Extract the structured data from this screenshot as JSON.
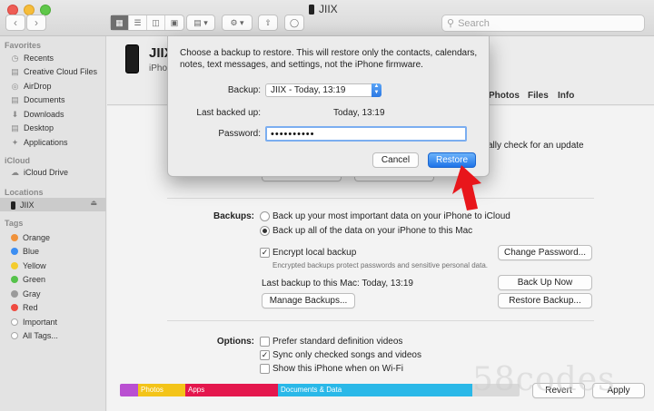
{
  "window": {
    "title": "JIIX",
    "search_placeholder": "Search"
  },
  "sidebar": {
    "favorites_header": "Favorites",
    "favorites": [
      "Recents",
      "Creative Cloud Files",
      "AirDrop",
      "Documents",
      "Downloads",
      "Desktop",
      "Applications"
    ],
    "icloud_header": "iCloud",
    "icloud": [
      "iCloud Drive"
    ],
    "locations_header": "Locations",
    "location": "JIIX",
    "tags_header": "Tags",
    "tags": [
      {
        "label": "Orange",
        "color": "#f0923b"
      },
      {
        "label": "Blue",
        "color": "#3c8ef2"
      },
      {
        "label": "Yellow",
        "color": "#f4cc2e"
      },
      {
        "label": "Green",
        "color": "#55c24a"
      },
      {
        "label": "Gray",
        "color": "#9a9a9a"
      },
      {
        "label": "Red",
        "color": "#ef4a40"
      },
      {
        "label": "Important",
        "color": "#ffffff"
      },
      {
        "label": "All Tags...",
        "color": "#ffffff"
      }
    ]
  },
  "device": {
    "name": "JIIX",
    "subtitle": "iPhone"
  },
  "tabs": [
    "Photos",
    "Files",
    "Info"
  ],
  "general": {
    "update_text": "cally check for an update"
  },
  "backups": {
    "label": "Backups:",
    "option_icloud": "Back up your most important data on your iPhone to iCloud",
    "option_mac": "Back up all of the data on your iPhone to this Mac",
    "encrypt": "Encrypt local backup",
    "encrypt_note": "Encrypted backups protect passwords and sensitive personal data.",
    "last_backup": "Last backup to this Mac: Today, 13:19",
    "change_password": "Change Password...",
    "back_up_now": "Back Up Now",
    "manage_backups": "Manage Backups...",
    "restore_backup": "Restore Backup..."
  },
  "options": {
    "label": "Options:",
    "items": [
      "Prefer standard definition videos",
      "Sync only checked songs and videos",
      "Show this iPhone when on Wi-Fi"
    ]
  },
  "storage": {
    "photos": "Photos",
    "apps": "Apps",
    "documents": "Documents & Data",
    "revert": "Revert",
    "apply": "Apply"
  },
  "dialog": {
    "message": "Choose a backup to restore. This will restore only the contacts, calendars, notes, text messages, and settings, not the iPhone firmware.",
    "backup_label": "Backup:",
    "backup_value": "JIIX - Today, 13:19",
    "last_backed_up_label": "Last backed up:",
    "last_backed_up_value": "Today, 13:19",
    "password_label": "Password:",
    "password_value": "••••••••••",
    "cancel": "Cancel",
    "restore": "Restore"
  },
  "watermark": "58codes",
  "colors": {
    "accent": "#2b78e4",
    "arrow": "#e8161b",
    "photos_seg": "#f3c419",
    "apps_seg": "#e4174d",
    "docs_seg": "#2ab8e8"
  }
}
